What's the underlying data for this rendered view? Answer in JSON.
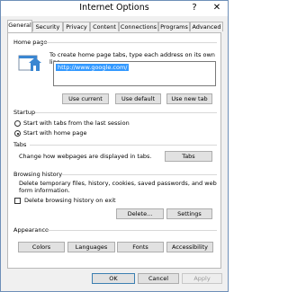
{
  "window": {
    "title": "Internet Options",
    "help_glyph": "?",
    "close_glyph": "✕"
  },
  "tabs": [
    "General",
    "Security",
    "Privacy",
    "Content",
    "Connections",
    "Programs",
    "Advanced"
  ],
  "home_page": {
    "section": "Home page",
    "instruction": "To create home page tabs, type each address on its own line.",
    "url": "http://www.google.com/",
    "use_current": "Use current",
    "use_default": "Use default",
    "use_new_tab": "Use new tab"
  },
  "startup": {
    "section": "Startup",
    "option1": "Start with tabs from the last session",
    "option2": "Start with home page",
    "selected": "option2"
  },
  "tabs_section": {
    "section": "Tabs",
    "description": "Change how webpages are displayed in tabs.",
    "button": "Tabs"
  },
  "browsing_history": {
    "section": "Browsing history",
    "description_line1": "Delete temporary files, history, cookies, saved passwords, and web",
    "description_line2": "form information.",
    "delete_on_exit": "Delete browsing history on exit",
    "delete_button": "Delete...",
    "settings_button": "Settings"
  },
  "appearance": {
    "section": "Appearance",
    "colors": "Colors",
    "languages": "Languages",
    "fonts": "Fonts",
    "accessibility": "Accessibility"
  },
  "footer": {
    "ok": "OK",
    "cancel": "Cancel",
    "apply": "Apply"
  },
  "colors": {
    "selection": "#3399ff",
    "window_border": "#6e8fb8",
    "icon_blue": "#3a86d1"
  }
}
